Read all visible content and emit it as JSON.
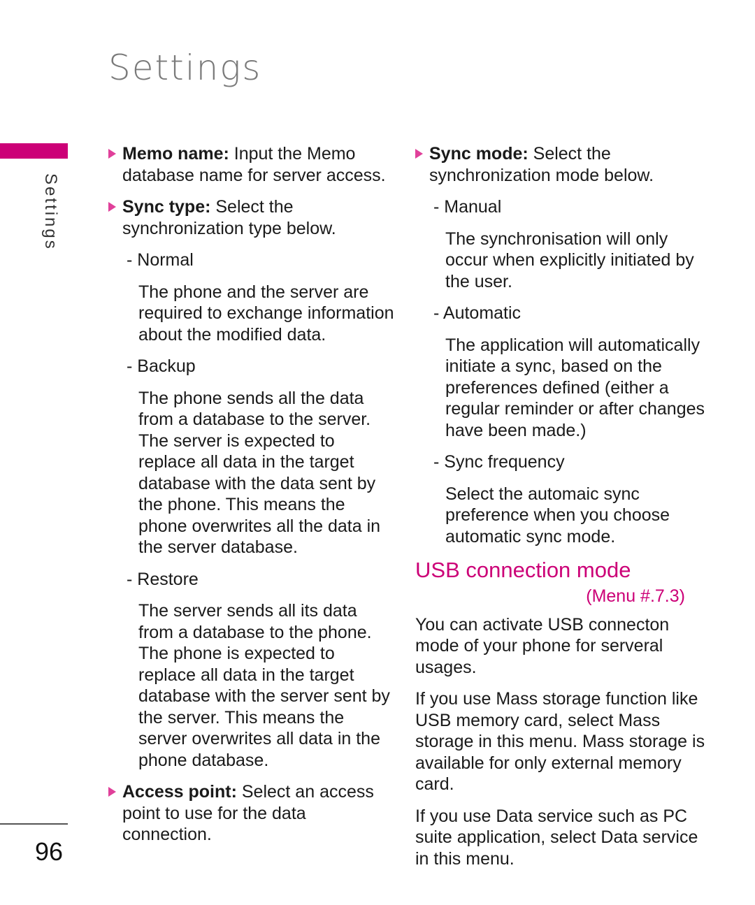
{
  "header": {
    "title": "Settings",
    "side_label": "Settings",
    "page_number": "96",
    "accent": "#cc0077"
  },
  "left": {
    "memo": {
      "label": "Memo name:",
      "text": " Input the Memo database name for server access."
    },
    "sync_type": {
      "label": "Sync type:",
      "text": " Select the synchronization type below."
    },
    "normal": {
      "title": "- Normal",
      "desc": "The phone and the server are required to exchange information about the modified data."
    },
    "backup": {
      "title": "- Backup",
      "desc": "The phone sends all the data from a database to the server. The server is expected to replace all data in the target database with the data sent by the phone. This means the phone overwrites all the data in the server database."
    },
    "restore": {
      "title": "- Restore",
      "desc": "The server sends all its data from a database to the phone. The phone is expected to replace all data in the target database with the server sent by the server. This means the server overwrites all data in the phone database."
    },
    "access": {
      "label": "Access point:",
      "text": " Select an access point to use for the data connection."
    }
  },
  "right": {
    "sync_mode": {
      "label": "Sync mode:",
      "text": " Select the synchronization mode below."
    },
    "manual": {
      "title": "- Manual",
      "desc": "The synchronisation will only occur when explicitly initiated by the user."
    },
    "automatic": {
      "title": "- Automatic",
      "desc": "The application will automatically initiate a sync, based on the preferences defined (either a regular reminder or after changes have been made.)"
    },
    "frequency": {
      "title": "- Sync frequency",
      "desc": "Select the automaic sync preference when you choose automatic sync mode."
    },
    "usb": {
      "heading": "USB connection mode",
      "menu": "(Menu #.7.3)",
      "p1": "You can activate USB connecton mode of your phone for serveral usages.",
      "p2": "If you use Mass storage function like USB memory card, select Mass storage in this menu. Mass storage is available for only external memory card.",
      "p3": "If you use Data service such as PC suite application, select Data service in this menu."
    }
  }
}
